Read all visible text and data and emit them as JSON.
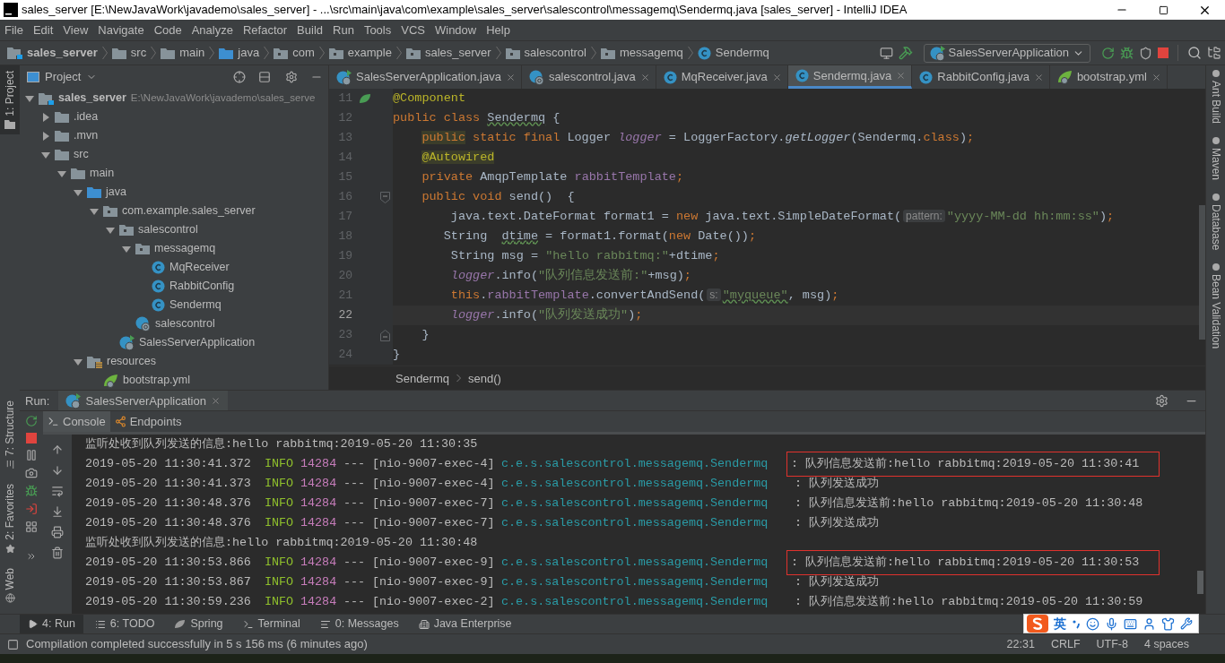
{
  "window": {
    "title": "sales_server [E:\\NewJavaWork\\javademo\\sales_server] - ...\\src\\main\\java\\com\\example\\sales_server\\salescontrol\\messagemq\\Sendermq.java [sales_server] - IntelliJ IDEA"
  },
  "menu": [
    "File",
    "Edit",
    "View",
    "Navigate",
    "Code",
    "Analyze",
    "Refactor",
    "Build",
    "Run",
    "Tools",
    "VCS",
    "Window",
    "Help"
  ],
  "breadcrumbs": [
    {
      "label": "sales_server",
      "kind": "module"
    },
    {
      "label": "src",
      "kind": "folder"
    },
    {
      "label": "main",
      "kind": "folder"
    },
    {
      "label": "java",
      "kind": "source"
    },
    {
      "label": "com",
      "kind": "package"
    },
    {
      "label": "example",
      "kind": "package"
    },
    {
      "label": "sales_server",
      "kind": "package"
    },
    {
      "label": "salescontrol",
      "kind": "package"
    },
    {
      "label": "messagemq",
      "kind": "package"
    },
    {
      "label": "Sendermq",
      "kind": "class"
    }
  ],
  "run_config": "SalesServerApplication",
  "left_stripe_top": [
    {
      "label": "1: Project",
      "selected": true
    }
  ],
  "left_stripe_bottom": [
    {
      "label": "7: Structure",
      "kind": "structure",
      "selected": false
    },
    {
      "label": "2: Favorites",
      "kind": "favorites",
      "selected": false
    },
    {
      "label": "Web",
      "kind": "web",
      "selected": false
    }
  ],
  "project_panel": {
    "title": "Project",
    "tree": [
      {
        "label": "sales_server",
        "kind": "module",
        "path": "E:\\NewJavaWork\\javademo\\sales_serve",
        "expanded": true,
        "children": [
          {
            "label": ".idea",
            "kind": "folder",
            "expanded": false
          },
          {
            "label": ".mvn",
            "kind": "folder",
            "expanded": false
          },
          {
            "label": "src",
            "kind": "folder",
            "expanded": true,
            "children": [
              {
                "label": "main",
                "kind": "folder",
                "expanded": true,
                "children": [
                  {
                    "label": "java",
                    "kind": "source",
                    "expanded": true,
                    "children": [
                      {
                        "label": "com.example.sales_server",
                        "kind": "package",
                        "expanded": true,
                        "children": [
                          {
                            "label": "salescontrol",
                            "kind": "package",
                            "expanded": true,
                            "children": [
                              {
                                "label": "messagemq",
                                "kind": "package",
                                "expanded": true,
                                "children": [
                                  {
                                    "label": "MqReceiver",
                                    "kind": "class"
                                  },
                                  {
                                    "label": "RabbitConfig",
                                    "kind": "class"
                                  },
                                  {
                                    "label": "Sendermq",
                                    "kind": "class"
                                  }
                                ]
                              },
                              {
                                "label": "salescontrol",
                                "kind": "spring"
                              }
                            ]
                          },
                          {
                            "label": "SalesServerApplication",
                            "kind": "app"
                          }
                        ]
                      }
                    ]
                  },
                  {
                    "label": "resources",
                    "kind": "resources",
                    "expanded": true,
                    "children": [
                      {
                        "label": "bootstrap.yml",
                        "kind": "yml"
                      }
                    ]
                  }
                ]
              }
            ]
          }
        ]
      }
    ]
  },
  "editor_tabs": [
    {
      "label": "SalesServerApplication.java",
      "kind": "app",
      "selected": false
    },
    {
      "label": "salescontrol.java",
      "kind": "spring",
      "selected": false
    },
    {
      "label": "MqReceiver.java",
      "kind": "class",
      "selected": false
    },
    {
      "label": "Sendermq.java",
      "kind": "class",
      "selected": true
    },
    {
      "label": "RabbitConfig.java",
      "kind": "class",
      "selected": false
    },
    {
      "label": "bootstrap.yml",
      "kind": "yml",
      "selected": false
    }
  ],
  "code_lines": [
    {
      "number": "11",
      "current": false,
      "bean": true,
      "fold_start": false,
      "fold_end": false,
      "tokens": [
        {
          "kind": "ann",
          "text": "@Component"
        }
      ]
    },
    {
      "number": "12",
      "current": false,
      "bean": false,
      "fold_start": false,
      "fold_end": false,
      "tokens": [
        {
          "kind": "kw",
          "text": "public class "
        },
        {
          "kind": "typo",
          "text": "Sendermq"
        },
        {
          "kind": "plain",
          "text": " {"
        }
      ]
    },
    {
      "number": "13",
      "current": false,
      "bean": false,
      "fold_start": false,
      "fold_end": false,
      "tokens": [
        {
          "kind": "kw_marked",
          "text": "    public"
        },
        {
          "kind": "kw",
          "text": " static final "
        },
        {
          "kind": "plain",
          "text": "Logger "
        },
        {
          "kind": "italic",
          "text": "logger"
        },
        {
          "kind": "plain",
          "text": " = LoggerFactory."
        },
        {
          "kind": "method",
          "text": "getLogger"
        },
        {
          "kind": "plain",
          "text": "(Sendermq."
        },
        {
          "kind": "kw",
          "text": "class"
        },
        {
          "kind": "plain",
          "text": ")"
        },
        {
          "kind": "kw",
          "text": ";"
        }
      ]
    },
    {
      "number": "14",
      "current": false,
      "bean": false,
      "fold_start": false,
      "fold_end": false,
      "tokens": [
        {
          "kind": "ann_marked",
          "text": "    @Autowired"
        }
      ]
    },
    {
      "number": "15",
      "current": false,
      "bean": false,
      "fold_start": false,
      "fold_end": false,
      "tokens": [
        {
          "kind": "kw",
          "text": "    private "
        },
        {
          "kind": "plain",
          "text": "AmqpTemplate "
        },
        {
          "kind": "field",
          "text": "rabbitTemplate"
        },
        {
          "kind": "kw",
          "text": ";"
        }
      ]
    },
    {
      "number": "16",
      "current": false,
      "bean": false,
      "fold_start": true,
      "fold_end": false,
      "tokens": [
        {
          "kind": "kw",
          "text": "    public void "
        },
        {
          "kind": "plain",
          "text": "send()  {"
        }
      ]
    },
    {
      "number": "17",
      "current": false,
      "bean": false,
      "fold_start": false,
      "fold_end": false,
      "tokens": [
        {
          "kind": "plain",
          "text": "        java.text.DateFormat format1 = "
        },
        {
          "kind": "kw",
          "text": "new "
        },
        {
          "kind": "plain",
          "text": "java.text.SimpleDateFormat("
        },
        {
          "kind": "hint",
          "text": "pattern:"
        },
        {
          "kind": "str",
          "text": "\"yyyy-MM-dd hh:mm:ss\""
        },
        {
          "kind": "plain",
          "text": ")"
        },
        {
          "kind": "kw",
          "text": ";"
        }
      ]
    },
    {
      "number": "18",
      "current": false,
      "bean": false,
      "fold_start": false,
      "fold_end": false,
      "tokens": [
        {
          "kind": "plain",
          "text": "       String  "
        },
        {
          "kind": "typo",
          "text": "dtime"
        },
        {
          "kind": "plain",
          "text": " = format1.format("
        },
        {
          "kind": "kw",
          "text": "new "
        },
        {
          "kind": "plain",
          "text": "Date())"
        },
        {
          "kind": "kw",
          "text": ";"
        }
      ]
    },
    {
      "number": "19",
      "current": false,
      "bean": false,
      "fold_start": false,
      "fold_end": false,
      "tokens": [
        {
          "kind": "plain",
          "text": "        String msg = "
        },
        {
          "kind": "str",
          "text": "\"hello rabbitmq:\""
        },
        {
          "kind": "plain",
          "text": "+dtime"
        },
        {
          "kind": "kw",
          "text": ";"
        }
      ]
    },
    {
      "number": "20",
      "current": false,
      "bean": false,
      "fold_start": false,
      "fold_end": false,
      "tokens": [
        {
          "kind": "italic",
          "text": "        logger"
        },
        {
          "kind": "plain",
          "text": ".info("
        },
        {
          "kind": "str",
          "text": "\"队列信息发送前:\""
        },
        {
          "kind": "plain",
          "text": "+msg)"
        },
        {
          "kind": "kw",
          "text": ";"
        }
      ]
    },
    {
      "number": "21",
      "current": false,
      "bean": false,
      "fold_start": false,
      "fold_end": false,
      "tokens": [
        {
          "kind": "kw",
          "text": "        this"
        },
        {
          "kind": "plain",
          "text": "."
        },
        {
          "kind": "field",
          "text": "rabbitTemplate"
        },
        {
          "kind": "plain",
          "text": ".convertAndSend("
        },
        {
          "kind": "hint",
          "text": "s:"
        },
        {
          "kind": "str_typo",
          "text": "\"myqueue\""
        },
        {
          "kind": "plain",
          "text": ", msg)"
        },
        {
          "kind": "kw",
          "text": ";"
        }
      ]
    },
    {
      "number": "22",
      "current": true,
      "bean": false,
      "fold_start": false,
      "fold_end": false,
      "tokens": [
        {
          "kind": "italic",
          "text": "        logger"
        },
        {
          "kind": "plain",
          "text": ".info("
        },
        {
          "kind": "str",
          "text": "\"队列发送成功\""
        },
        {
          "kind": "plain",
          "text": ")"
        },
        {
          "kind": "kw",
          "text": ";"
        }
      ]
    },
    {
      "number": "23",
      "current": false,
      "bean": false,
      "fold_start": false,
      "fold_end": true,
      "tokens": [
        {
          "kind": "plain",
          "text": "    }"
        }
      ]
    },
    {
      "number": "24",
      "current": false,
      "bean": false,
      "fold_start": false,
      "fold_end": false,
      "tokens": [
        {
          "kind": "plain",
          "text": "}"
        }
      ]
    }
  ],
  "editor_breadcrumb": [
    "Sendermq",
    "send()"
  ],
  "right_stripe": [
    "Ant Build",
    "Maven",
    "Database",
    "Bean Validation"
  ],
  "run_panel": {
    "label": "Run:",
    "tab": "SalesServerApplication",
    "subtabs": [
      {
        "label": "Console",
        "kind": "console",
        "selected": true
      },
      {
        "label": "Endpoints",
        "kind": "endpoints",
        "selected": false
      }
    ],
    "lines": [
      {
        "kind": "message",
        "text": "监听处收到队列发送的信息:hello rabbitmq:2019-05-20 11:30:35"
      },
      {
        "kind": "log",
        "timestamp": "2019-05-20 11:30:41.372",
        "level": "INFO",
        "pid": "14284",
        "separator": "---",
        "thread": "[nio-9007-exec-4]",
        "logger": "c.e.s.salescontrol.messagemq.Sendermq",
        "text": ": 队列信息发送前:hello rabbitmq:2019-05-20 11:30:41",
        "boxed": true
      },
      {
        "kind": "log",
        "timestamp": "2019-05-20 11:30:41.373",
        "level": "INFO",
        "pid": "14284",
        "separator": "---",
        "thread": "[nio-9007-exec-4]",
        "logger": "c.e.s.salescontrol.messagemq.Sendermq",
        "text": ": 队列发送成功",
        "boxed": false
      },
      {
        "kind": "log",
        "timestamp": "2019-05-20 11:30:48.376",
        "level": "INFO",
        "pid": "14284",
        "separator": "---",
        "thread": "[nio-9007-exec-7]",
        "logger": "c.e.s.salescontrol.messagemq.Sendermq",
        "text": ": 队列信息发送前:hello rabbitmq:2019-05-20 11:30:48",
        "boxed": false
      },
      {
        "kind": "log",
        "timestamp": "2019-05-20 11:30:48.376",
        "level": "INFO",
        "pid": "14284",
        "separator": "---",
        "thread": "[nio-9007-exec-7]",
        "logger": "c.e.s.salescontrol.messagemq.Sendermq",
        "text": ": 队列发送成功",
        "boxed": false
      },
      {
        "kind": "message",
        "text": "监听处收到队列发送的信息:hello rabbitmq:2019-05-20 11:30:48"
      },
      {
        "kind": "log",
        "timestamp": "2019-05-20 11:30:53.866",
        "level": "INFO",
        "pid": "14284",
        "separator": "---",
        "thread": "[nio-9007-exec-9]",
        "logger": "c.e.s.salescontrol.messagemq.Sendermq",
        "text": ": 队列信息发送前:hello rabbitmq:2019-05-20 11:30:53",
        "boxed": true
      },
      {
        "kind": "log",
        "timestamp": "2019-05-20 11:30:53.867",
        "level": "INFO",
        "pid": "14284",
        "separator": "---",
        "thread": "[nio-9007-exec-9]",
        "logger": "c.e.s.salescontrol.messagemq.Sendermq",
        "text": ": 队列发送成功",
        "boxed": false
      },
      {
        "kind": "log",
        "timestamp": "2019-05-20 11:30:59.236",
        "level": "INFO",
        "pid": "14284",
        "separator": "---",
        "thread": "[nio-9007-exec-2]",
        "logger": "c.e.s.salescontrol.messagemq.Sendermq",
        "text": ": 队列信息发送前:hello rabbitmq:2019-05-20 11:30:59",
        "boxed": false
      }
    ]
  },
  "tool_tabs": [
    {
      "label": "4: Run",
      "kind": "run",
      "selected": true
    },
    {
      "label": "6: TODO",
      "kind": "todo",
      "selected": false
    },
    {
      "label": "Spring",
      "kind": "spring",
      "selected": false
    },
    {
      "label": "Terminal",
      "kind": "terminal",
      "selected": false
    },
    {
      "label": "0: Messages",
      "kind": "messages",
      "selected": false
    },
    {
      "label": "Java Enterprise",
      "kind": "enterprise",
      "selected": false
    }
  ],
  "status_bar": {
    "message": "Compilation completed successfully in 5 s 156 ms (6 minutes ago)",
    "items": [
      "22:31",
      "CRLF",
      "UTF-8",
      "4 spaces"
    ]
  },
  "ime": {
    "label": "英"
  }
}
